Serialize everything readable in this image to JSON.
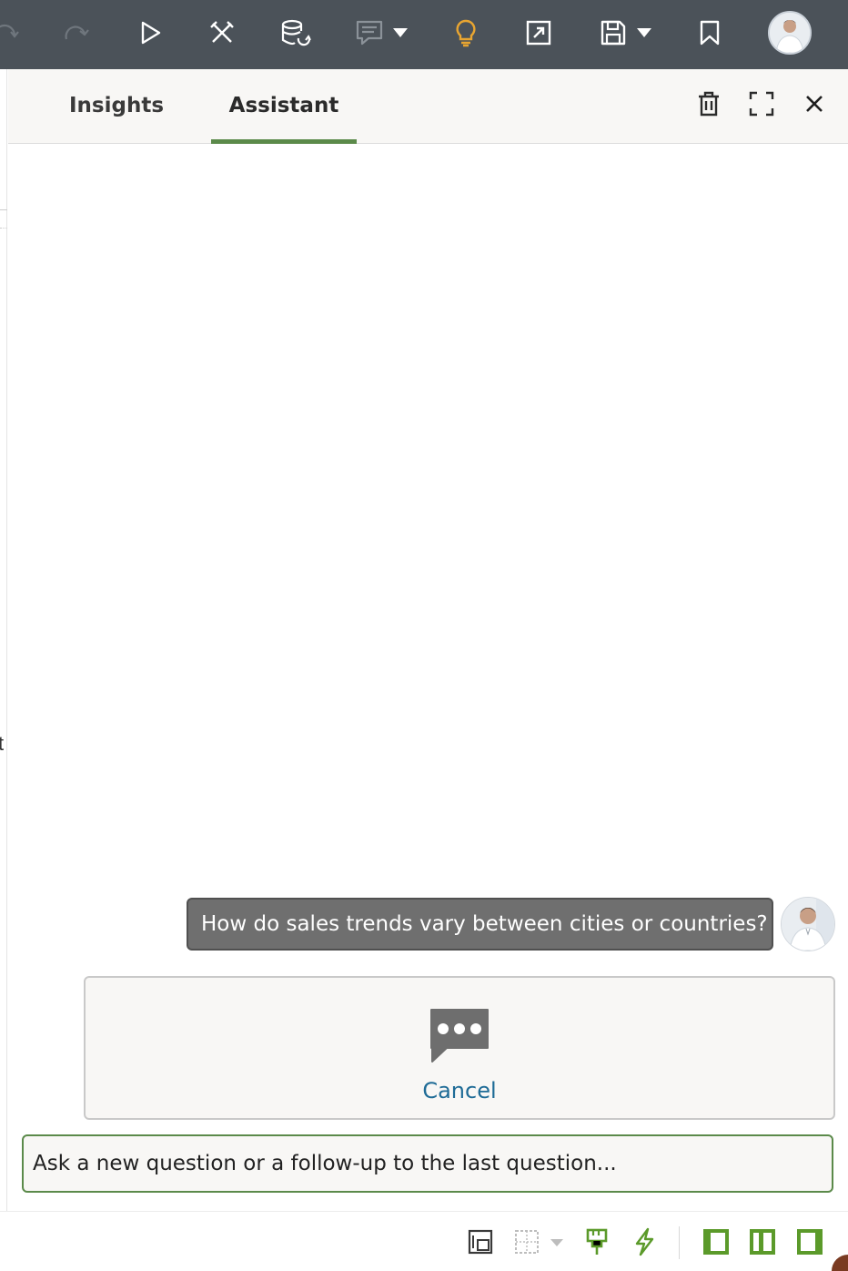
{
  "toolbar": {
    "items": [
      {
        "name": "undo-icon"
      },
      {
        "name": "redo-icon"
      },
      {
        "name": "play-icon"
      },
      {
        "name": "tools-icon"
      },
      {
        "name": "data-refresh-icon"
      },
      {
        "name": "comment-icon"
      },
      {
        "name": "lightbulb-icon"
      },
      {
        "name": "export-icon"
      },
      {
        "name": "save-icon"
      },
      {
        "name": "bookmark-icon"
      }
    ],
    "accent_lightbulb": "#e8a531"
  },
  "panel": {
    "tabs": [
      {
        "label": "Insights",
        "active": false
      },
      {
        "label": "Assistant",
        "active": true
      }
    ],
    "actions": [
      "trash-icon",
      "expand-icon",
      "close-icon"
    ]
  },
  "chat": {
    "user_question": "How do sales trends vary between cities or countries?",
    "cancel_label": "Cancel",
    "input_placeholder": "Ask a new question or a follow-up to the last question..."
  },
  "left_fragment": "t",
  "colors": {
    "toolbar_bg": "#4b5259",
    "accent_green": "#5b8a4a",
    "link_blue": "#1e6b96",
    "bubble_gray": "#6f6f6f"
  }
}
